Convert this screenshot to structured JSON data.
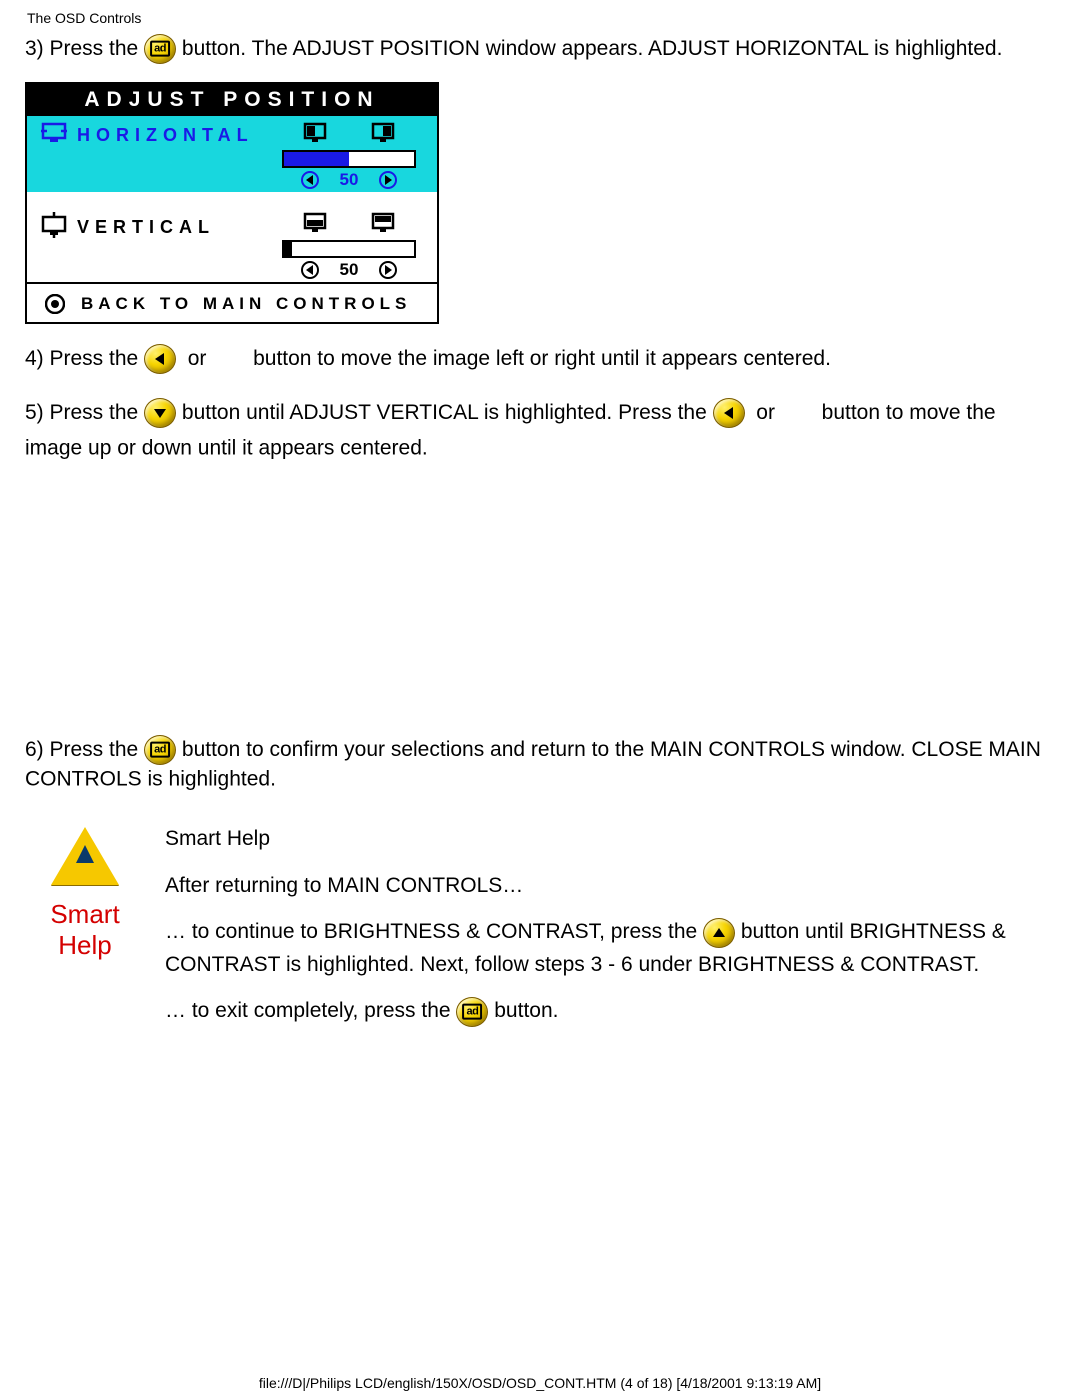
{
  "header": {
    "title": "The OSD Controls"
  },
  "step3": {
    "pre": "3) Press the ",
    "post": " button. The ADJUST POSITION window appears. ADJUST HORIZONTAL is highlighted."
  },
  "osd": {
    "title": "ADJUST POSITION",
    "horizontal": {
      "label": "HORIZONTAL",
      "value": "50",
      "fill": 50
    },
    "vertical": {
      "label": "VERTICAL",
      "value": "50",
      "fill": 5
    },
    "footer": "BACK TO MAIN CONTROLS"
  },
  "step4": {
    "pre": "4) Press the",
    "mid": " or        button to move the image left or right until it appears centered."
  },
  "step5": {
    "a": "5) Press the ",
    "b": " button until ADJUST VERTICAL is highlighted. Press the ",
    "c": " or        button to move the",
    "d": "image up or down until it appears centered."
  },
  "step6": {
    "pre": "6) Press the ",
    "post": " button to confirm your selections and return to the MAIN CONTROLS window. CLOSE MAIN CONTROLS is highlighted."
  },
  "smarthelp": {
    "label": "Smart Help",
    "title": "Smart Help",
    "line1": "After returning to MAIN CONTROLS…",
    "line2a": "… to continue to BRIGHTNESS & CONTRAST, press the ",
    "line2b": " button until BRIGHTNESS & CONTRAST is highlighted. Next, follow steps 3 - 6 under BRIGHTNESS & CONTRAST.",
    "line3a": "… to exit completely, press the ",
    "line3b": " button."
  },
  "footer": "file:///D|/Philips LCD/english/150X/OSD/OSD_CONT.HTM (4 of 18) [4/18/2001 9:13:19 AM]"
}
